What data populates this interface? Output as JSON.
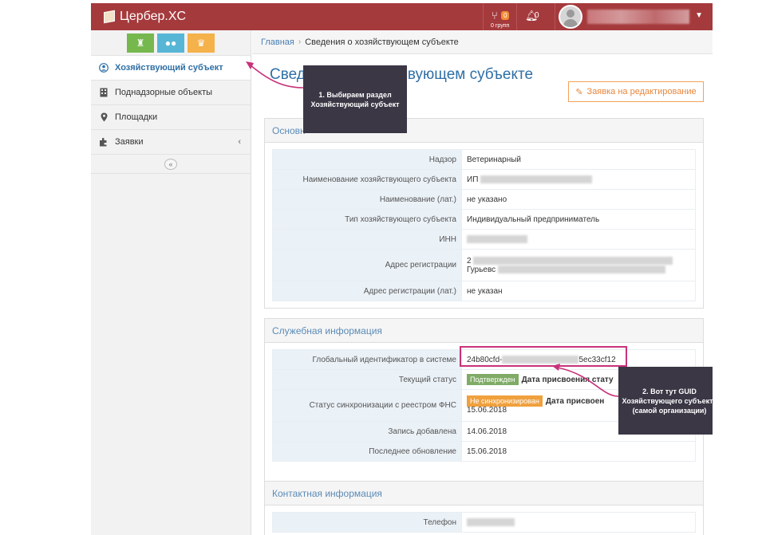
{
  "app": {
    "brand": "Цербер.XC",
    "branch_badge": "0",
    "branch_sub": "0 групп",
    "notif_count": "0"
  },
  "sidebar": {
    "items": [
      {
        "label": "Хозяйствующий субъект",
        "icon": "user-circle-icon",
        "active": true
      },
      {
        "label": "Поднадзорные объекты",
        "icon": "building-icon"
      },
      {
        "label": "Площадки",
        "icon": "map-marker-icon"
      },
      {
        "label": "Заявки",
        "icon": "puzzle-icon"
      }
    ],
    "buttons": [
      {
        "icon": "trophy-icon",
        "color": "#76b84e"
      },
      {
        "icon": "users-icon",
        "color": "#57b6d6"
      },
      {
        "icon": "crown-icon",
        "color": "#f5b14a"
      }
    ]
  },
  "breadcrumbs": {
    "home": "Главная",
    "current": "Сведения о хозяйствующем субъекте"
  },
  "page": {
    "title_left": "Свед",
    "title_right": "вующем субъекте",
    "edit_button": "Заявка на редактирование"
  },
  "main_info": {
    "heading": "Основн",
    "rows": [
      {
        "label": "Надзор",
        "value": "Ветеринарный"
      },
      {
        "label": "Наименование хозяйствующего субъекта",
        "value": "ИП"
      },
      {
        "label": "Наименование (лат.)",
        "value": "не указано"
      },
      {
        "label": "Тип хозяйствующего субъекта",
        "value": "Индивидуальный предприниматель"
      },
      {
        "label": "ИНН",
        "value": ""
      },
      {
        "label": "Адрес регистрации",
        "value": "2",
        "value2": "Гурьевс"
      },
      {
        "label": "Адрес регистрации (лат.)",
        "value": "не указан"
      }
    ]
  },
  "service_info": {
    "heading": "Служебная информация",
    "guid_label": "Глобальный идентификатор в системе",
    "guid_start": "24b80cfd-",
    "guid_end": "5ec33cf12",
    "status_label": "Текущий статус",
    "status_badge": "Подтвержден",
    "status_text": "Дата присвоения стату",
    "sync_label": "Статус синхронизации с реестром ФНС",
    "sync_badge": "Не синхронизирован",
    "sync_text": "Дата присвоен",
    "sync_date": "15.06.2018",
    "added_label": "Запись добавлена",
    "added_value": "14.06.2018",
    "updated_label": "Последнее обновление",
    "updated_value": "15.06.2018"
  },
  "contact_info": {
    "heading": "Контактная информация",
    "phone_label": "Телефон"
  },
  "callouts": {
    "one": "1. Выбираем раздел Хозяйствующий субъект",
    "two": "2. Вот тут GUID Хозяйствующего субъекта (самой организации)"
  },
  "colors": {
    "header": "#a53a3d",
    "accent_blue": "#2f6fa5",
    "callout_bg": "#3b3745",
    "highlight": "#c8327a"
  }
}
